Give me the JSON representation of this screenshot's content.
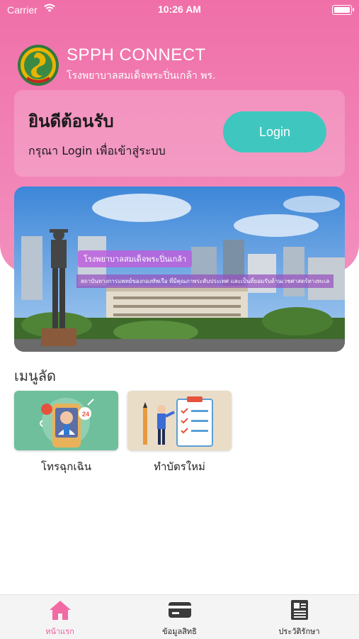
{
  "status_bar": {
    "carrier": "Carrier",
    "time": "10:26 AM"
  },
  "header": {
    "title": "SPPH CONNECT",
    "subtitle": "โรงพยาบาลสมเด็จพระปิ่นเกล้า พร."
  },
  "welcome": {
    "title": "ยินดีต้อนรับ",
    "subtitle": "กรุณา Login เพื่อเข้าสู่ระบบ",
    "login_label": "Login"
  },
  "banner": {
    "tag": "โรงพยาบาลสมเด็จพระปิ่นเกล้า",
    "caption": "สถาบันทางการแพทย์ของกองทัพเรือ ที่มีคุณภาพระดับประเทศ และเป็นที่ยอมรับด้านเวชศาสตร์ทางทะเล"
  },
  "shortcuts": {
    "title": "เมนูลัด",
    "items": [
      {
        "label": "โทรฉุกเฉิน",
        "icon": "emergency-call-icon"
      },
      {
        "label": "ทำบัตรใหม่",
        "icon": "new-card-icon"
      }
    ]
  },
  "tabs": [
    {
      "label": "หน้าแรก",
      "icon": "home-icon",
      "active": true
    },
    {
      "label": "ข้อมูลสิทธิ",
      "icon": "card-icon",
      "active": false
    },
    {
      "label": "ประวัติรักษา",
      "icon": "document-icon",
      "active": false
    }
  ],
  "colors": {
    "accent_pink": "#ef5d9d",
    "login_teal": "#3fc7bf",
    "emergency_bg": "#6fbf9c",
    "newcard_bg": "#e9ddc8"
  }
}
